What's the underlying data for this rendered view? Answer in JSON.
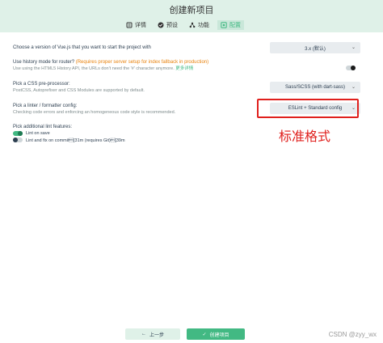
{
  "window": {
    "title": "创建新项目"
  },
  "tabs": [
    {
      "label": "详情",
      "icon": "details-icon",
      "active": false
    },
    {
      "label": "预设",
      "icon": "check-circle-icon",
      "active": false
    },
    {
      "label": "功能",
      "icon": "features-icon",
      "active": false
    },
    {
      "label": "配置",
      "icon": "config-icon",
      "active": true
    }
  ],
  "settings": {
    "vue_version": {
      "label": "Choose a version of Vue.js that you want to start the project with",
      "value": "3.x (默认)"
    },
    "history_mode": {
      "label": "Use history mode for router?",
      "warning": "(Requires proper server setup for index fallback in production)",
      "desc_prefix": "Use using the HTML5 History API, the URLs don't need the '#' character anymore.",
      "link": "更多详情",
      "enabled": false
    },
    "css": {
      "label": "Pick a CSS pre-processor:",
      "desc": "PostCSS, Autoprefixer and CSS Modules are supported by default.",
      "value": "Sass/SCSS (with dart-sass)"
    },
    "linter": {
      "label": "Pick a linter / formatter config:",
      "desc": "Checking code errors and enforcing an homogeneous code style is recommended.",
      "value": "ESLint + Standard config"
    },
    "lint_features": {
      "label": "Pick additional lint features:",
      "items": [
        {
          "label": "Lint on save",
          "enabled": true
        },
        {
          "label": "Lint and fix on commit\u001b[31m (requires Git)\u001b[39m",
          "enabled": false
        }
      ]
    }
  },
  "annotation": {
    "text": "标准格式"
  },
  "footer": {
    "prev_label": "上一步",
    "create_label": "创建项目"
  },
  "watermark": "CSDN @zyy_wx",
  "colors": {
    "accent": "#42b983",
    "annotation": "#e0201d",
    "warning": "#e8820c"
  }
}
